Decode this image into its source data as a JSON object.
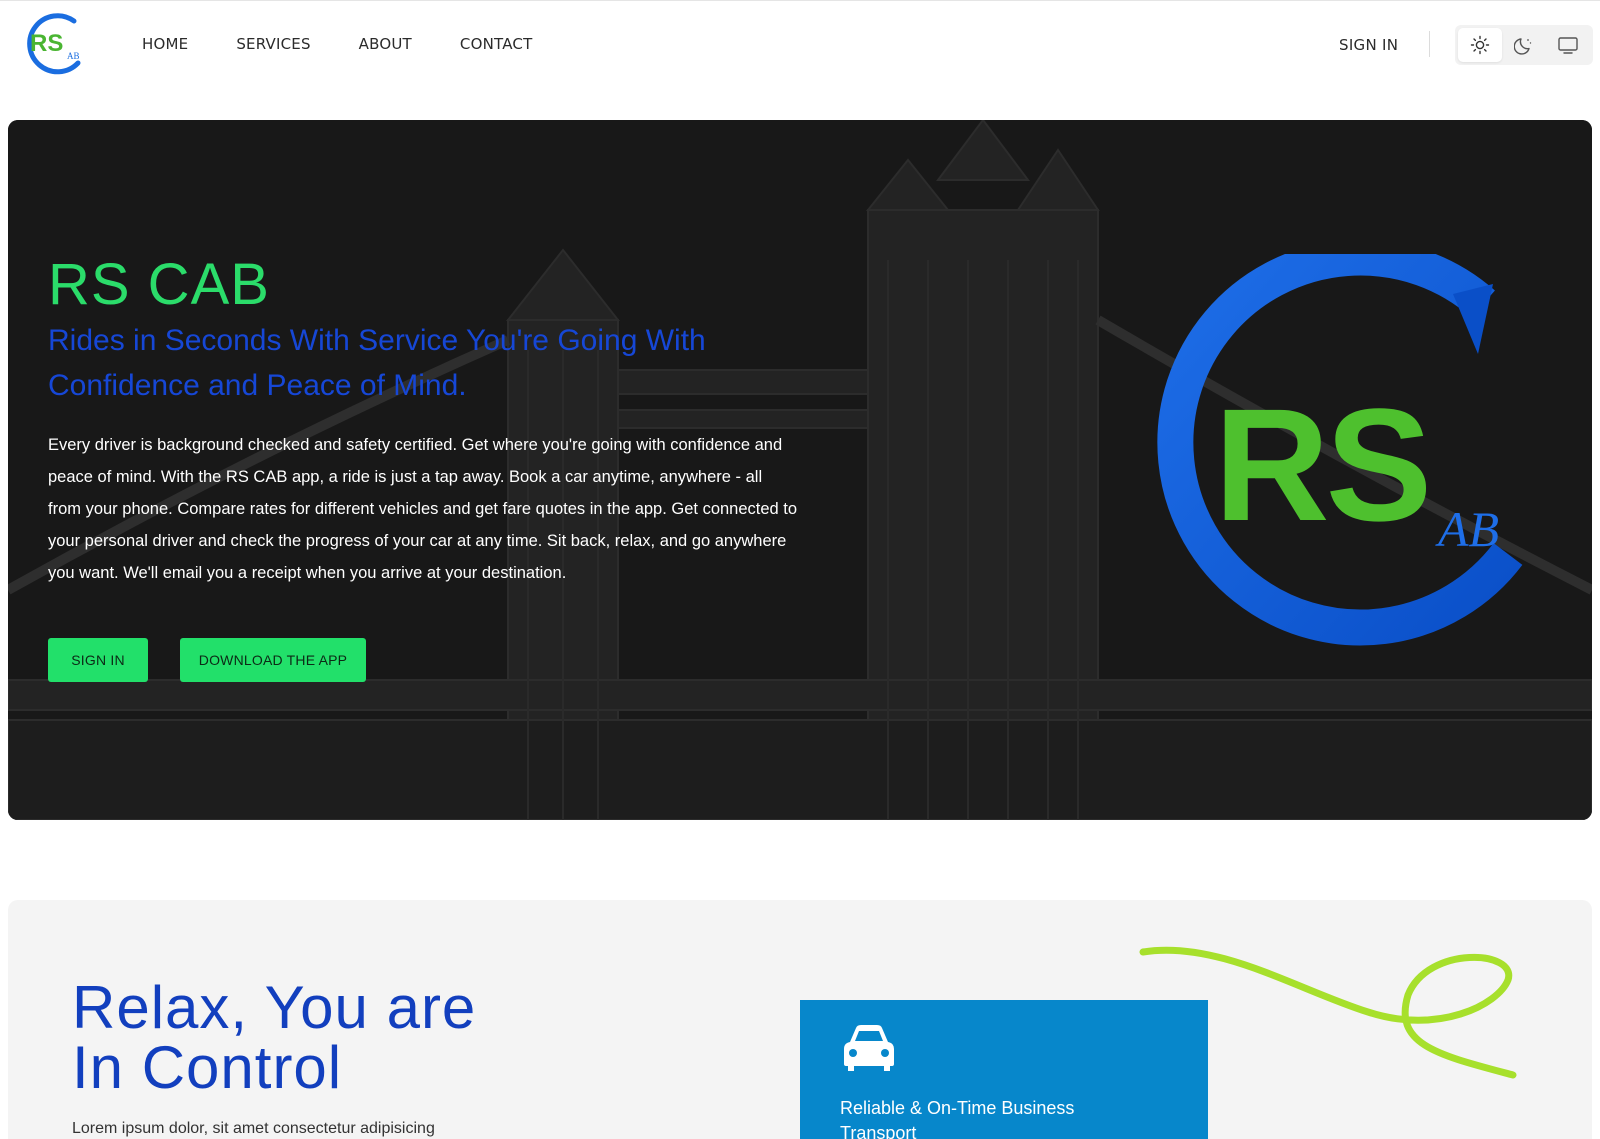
{
  "brand": {
    "logo_icon": "rs-cab-logo",
    "logo_letters": "RS",
    "logo_small": "AB"
  },
  "nav": {
    "items": [
      {
        "label": "HOME"
      },
      {
        "label": "SERVICES"
      },
      {
        "label": "ABOUT"
      },
      {
        "label": "CONTACT"
      }
    ],
    "signin_label": "SIGN IN"
  },
  "theme_switcher": {
    "options": [
      {
        "icon": "sun-icon",
        "active": true
      },
      {
        "icon": "moon-icon",
        "active": false
      },
      {
        "icon": "monitor-icon",
        "active": false
      }
    ]
  },
  "hero": {
    "title": "RS CAB",
    "subtitle": "Rides in Seconds With Service You're Going With Confidence and Peace of Mind.",
    "description": "Every driver is background checked and safety certified. Get where you're going with confidence and peace of mind. With the RS CAB app, a ride is just a tap away. Book a car anytime, anywhere - all from your phone. Compare rates for different vehicles and get fare quotes in the app. Get connected to your personal driver and check the progress of your car at any time. Sit back, relax, and go anywhere you want. We'll email you a receipt when you arrive at your destination.",
    "signin_button": "SIGN IN",
    "download_button": "DOWNLOAD THE APP",
    "background": "tower-bridge-sketch"
  },
  "section2": {
    "heading_line1": "Relax, You are",
    "heading_line2": "In Control",
    "body": "Lorem ipsum dolor, sit amet consectetur adipisicing",
    "card": {
      "icon": "car-icon",
      "title": "Reliable & On-Time Business Transport"
    }
  },
  "colors": {
    "green": "#22e06a",
    "blue": "#1647d6",
    "card_blue": "#0787cb",
    "hero_bg": "#181818"
  }
}
